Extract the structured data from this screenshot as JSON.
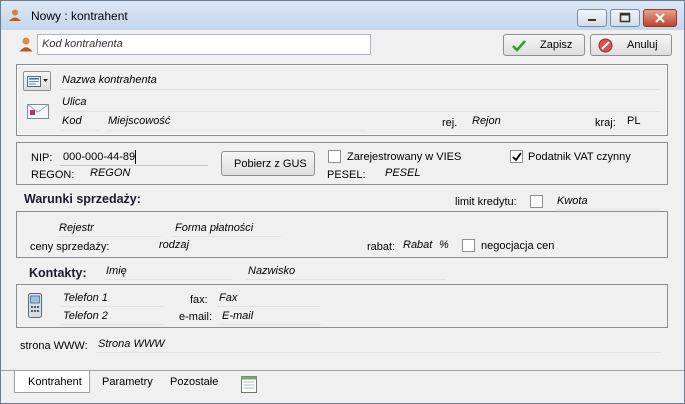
{
  "window": {
    "title": "Nowy : kontrahent"
  },
  "header": {
    "code_placeholder": "Kod kontrahenta",
    "save_label": "Zapisz",
    "cancel_label": "Anuluj"
  },
  "address": {
    "name_placeholder": "Nazwa kontrahenta",
    "street_placeholder": "Ulica",
    "postcode_placeholder": "Kod",
    "city_placeholder": "Miejscowość",
    "region_label": "rej.",
    "region_placeholder": "Rejon",
    "country_label": "kraj:",
    "country_value": "PL"
  },
  "ids": {
    "nip_label": "NIP:",
    "nip_value": "000-000-44-89",
    "gus_button_label": "Pobierz z GUS",
    "vies_label": "Zarejestrowany w VIES",
    "vies_checked": false,
    "vat_label": "Podatnik VAT czynny",
    "vat_checked": true,
    "regon_label": "REGON:",
    "regon_placeholder": "REGON",
    "pesel_label": "PESEL:",
    "pesel_placeholder": "PESEL"
  },
  "sales": {
    "heading": "Warunki sprzedaży:",
    "credit_limit_label": "limit kredytu:",
    "credit_limit_checked": false,
    "amount_placeholder": "Kwota",
    "register_placeholder": "Rejestr",
    "payment_form_placeholder": "Forma płatności",
    "prices_label": "ceny sprzedaży:",
    "price_type_placeholder": "rodzaj",
    "discount_label": "rabat:",
    "discount_placeholder": "Rabat",
    "percent_sign": "%",
    "negotiation_label": "negocjacja cen",
    "negotiation_checked": false
  },
  "contacts": {
    "heading": "Kontakty:",
    "first_name_placeholder": "Imię",
    "last_name_placeholder": "Nazwisko",
    "phone1_placeholder": "Telefon 1",
    "phone2_placeholder": "Telefon 2",
    "fax_label": "fax:",
    "fax_placeholder": "Fax",
    "email_label": "e-mail:",
    "email_placeholder": "E-mail",
    "www_label": "strona WWW:",
    "www_placeholder": "Strona WWW"
  },
  "tabs": [
    {
      "label": "Kontrahent",
      "active": true
    },
    {
      "label": "Parametry",
      "active": false
    },
    {
      "label": "Pozostałe",
      "active": false
    }
  ],
  "colors": {
    "save_check": "#2e9e2e",
    "cancel_icon": "#c0392b",
    "section_heading": "#1a1a2e"
  }
}
